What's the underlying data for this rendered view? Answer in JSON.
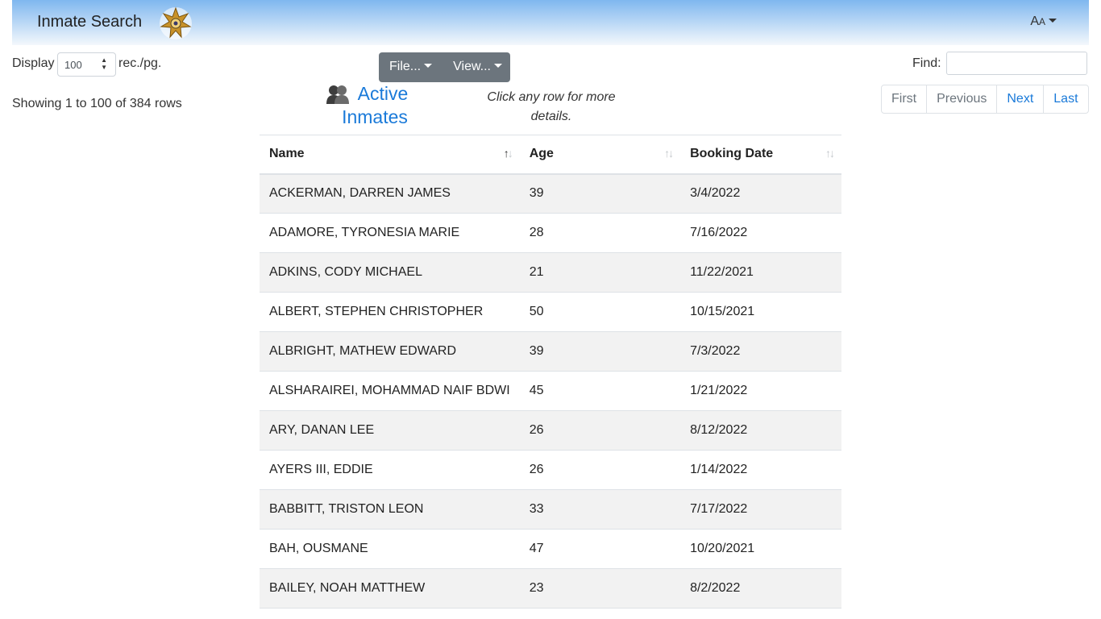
{
  "navbar": {
    "title": "Inmate Search",
    "font_menu_large": "A",
    "font_menu_small": "A"
  },
  "controls": {
    "display_label": "Display",
    "display_value": "100",
    "per_page_label": "rec./pg.",
    "showing": "Showing 1 to 100 of 384 rows",
    "file_button": "File...",
    "view_button": "View...",
    "title_line1": "Active",
    "title_line2": "Inmates",
    "hint": "Click any row for more details.",
    "find_label": "Find:",
    "find_value": ""
  },
  "pagination": {
    "first": "First",
    "previous": "Previous",
    "next": "Next",
    "last": "Last"
  },
  "table": {
    "headers": {
      "name": "Name",
      "age": "Age",
      "booking_date": "Booking Date"
    },
    "rows": [
      {
        "name": "ACKERMAN, DARREN JAMES",
        "age": "39",
        "booking_date": "3/4/2022"
      },
      {
        "name": "ADAMORE, TYRONESIA MARIE",
        "age": "28",
        "booking_date": "7/16/2022"
      },
      {
        "name": "ADKINS, CODY MICHAEL",
        "age": "21",
        "booking_date": "11/22/2021"
      },
      {
        "name": "ALBERT, STEPHEN CHRISTOPHER",
        "age": "50",
        "booking_date": "10/15/2021"
      },
      {
        "name": "ALBRIGHT, MATHEW EDWARD",
        "age": "39",
        "booking_date": "7/3/2022"
      },
      {
        "name": "ALSHARAIREI, MOHAMMAD NAIF BDWI",
        "age": "45",
        "booking_date": "1/21/2022"
      },
      {
        "name": "ARY, DANAN LEE",
        "age": "26",
        "booking_date": "8/12/2022"
      },
      {
        "name": "AYERS III, EDDIE",
        "age": "26",
        "booking_date": "1/14/2022"
      },
      {
        "name": "BABBITT, TRISTON LEON",
        "age": "33",
        "booking_date": "7/17/2022"
      },
      {
        "name": "BAH, OUSMANE",
        "age": "47",
        "booking_date": "10/20/2021"
      },
      {
        "name": "BAILEY, NOAH MATTHEW",
        "age": "23",
        "booking_date": "8/2/2022"
      }
    ]
  }
}
